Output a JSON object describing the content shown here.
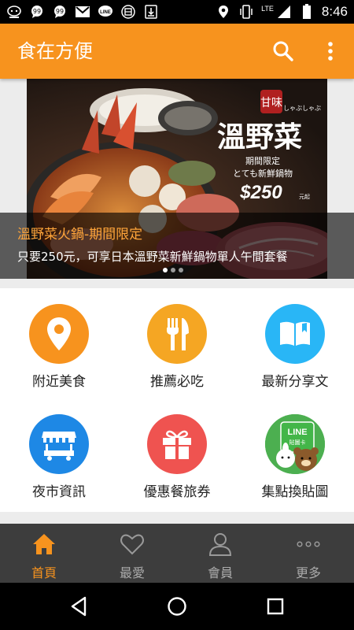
{
  "status_bar": {
    "time": "8:46",
    "network": "LTE",
    "left_icons": [
      "echo-app-icon",
      "chat-bubble-icon",
      "chat-bubble-icon",
      "gmail-icon",
      "line-icon",
      "food-app-icon",
      "download-icon"
    ],
    "right_icons": [
      "location-icon",
      "vibrate-icon",
      "signal-icon",
      "battery-icon"
    ]
  },
  "app_bar": {
    "title": "食在方便",
    "actions": [
      "search-icon",
      "more-vert-icon"
    ],
    "color": "#f7931e"
  },
  "banner": {
    "title": "溫野菜火鍋-期間限定",
    "subtitle": "只要250元，可享日本溫野菜新鮮鍋物單人午間套餐",
    "image_text": {
      "brand": "溫野菜",
      "brand_reading": "しゃぶしゃぶ",
      "seal": "甘味",
      "tagline_1": "期間限定",
      "tagline_2": "とても新鮮鍋物",
      "price": "$250",
      "price_suffix": "元起"
    },
    "slide_count": 3,
    "active_slide": 1
  },
  "grid": [
    {
      "label": "附近美食",
      "icon": "location-pin-icon",
      "color": "#f7931e"
    },
    {
      "label": "推薦必吃",
      "icon": "fork-knife-icon",
      "color": "#f5a623"
    },
    {
      "label": "最新分享文",
      "icon": "book-icon",
      "color": "#29b6f6"
    },
    {
      "label": "夜市資訊",
      "icon": "market-stall-icon",
      "color": "#1e88e5"
    },
    {
      "label": "優惠餐旅券",
      "icon": "gift-icon",
      "color": "#ef5350"
    },
    {
      "label": "集點換貼圖",
      "icon": "line-sticker-icon",
      "color": "#4caf50"
    }
  ],
  "line_badge": {
    "brand": "LINE",
    "caption": "貼圖卡"
  },
  "bottom_nav": [
    {
      "label": "首頁",
      "icon": "home-icon",
      "active": true
    },
    {
      "label": "最愛",
      "icon": "heart-icon",
      "active": false
    },
    {
      "label": "會員",
      "icon": "person-icon",
      "active": false
    },
    {
      "label": "更多",
      "icon": "more-horiz-icon",
      "active": false
    }
  ],
  "system_nav": [
    "back-icon",
    "home-circle-icon",
    "recents-icon"
  ]
}
